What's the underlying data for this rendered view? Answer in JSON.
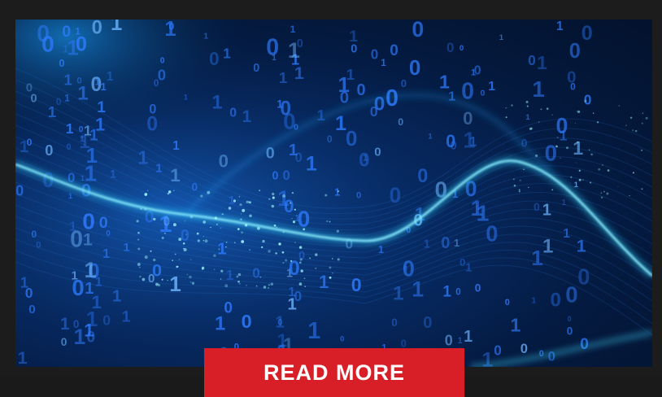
{
  "hero": {
    "image": "binary-code-wave-graphic",
    "colors": {
      "background_dark": "#03122d",
      "background_mid": "#072a63",
      "wave_glow": "#33d6ff",
      "digits": "#2e7bff"
    }
  },
  "cta": {
    "label": "READ MORE",
    "color": "#d81e27"
  }
}
